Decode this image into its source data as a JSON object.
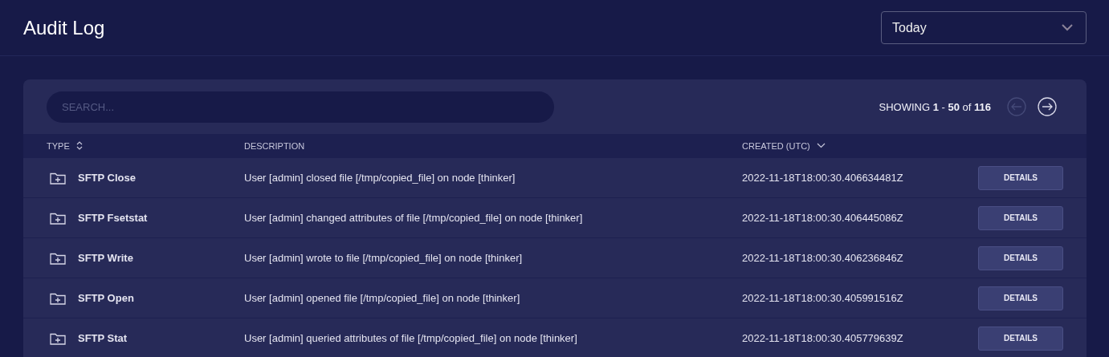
{
  "header": {
    "title": "Audit Log",
    "range_select": {
      "value": "Today"
    }
  },
  "toolbar": {
    "search": {
      "placeholder": "SEARCH..."
    },
    "showing": "SHOWING **1** - **50** of **116**",
    "pagination": [
      {
        "kind": "prev",
        "disabled": true
      },
      {
        "kind": "next",
        "disabled": false
      }
    ]
  },
  "table": {
    "columns": [
      {
        "label": "TYPE",
        "sortable": true,
        "sorted": false
      },
      {
        "label": "DESCRIPTION",
        "sortable": false
      },
      {
        "label": "CREATED (UTC)",
        "sortable": true,
        "sorted": true
      }
    ],
    "rows": [
      {
        "type": "SFTP Close",
        "description": "User [admin] closed file [/tmp/copied_file] on node [thinker]",
        "created": "2022-11-18T18:00:30.406634481Z",
        "action": "DETAILS"
      },
      {
        "type": "SFTP Fsetstat",
        "description": "User [admin] changed attributes of file [/tmp/copied_file] on node [thinker]",
        "created": "2022-11-18T18:00:30.406445086Z",
        "action": "DETAILS"
      },
      {
        "type": "SFTP Write",
        "description": "User [admin] wrote to file [/tmp/copied_file] on node [thinker]",
        "created": "2022-11-18T18:00:30.406236846Z",
        "action": "DETAILS"
      },
      {
        "type": "SFTP Open",
        "description": "User [admin] opened file [/tmp/copied_file] on node [thinker]",
        "created": "2022-11-18T18:00:30.405991516Z",
        "action": "DETAILS"
      },
      {
        "type": "SFTP Stat",
        "description": "User [admin] queried attributes of file [/tmp/copied_file] on node [thinker]",
        "created": "2022-11-18T18:00:30.405779639Z",
        "action": "DETAILS"
      }
    ]
  }
}
